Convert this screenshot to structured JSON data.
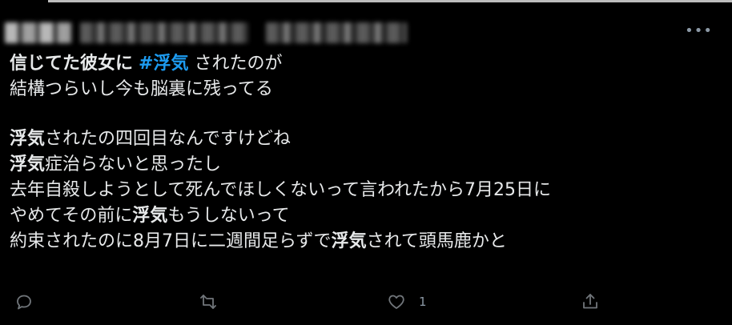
{
  "tweet": {
    "more_label": "•••",
    "segments": {
      "l1a": "信じてた彼女に",
      "l1tag": "#浮気",
      "l1b": "されたのが",
      "l2": "結構つらいし今も脳裏に残ってる",
      "l3a": "浮気",
      "l3b": "されたの四回目なんですけどね",
      "l4a": "浮気",
      "l4b": "症治らないと思ったし",
      "l5": "去年自殺しようとして死んでほしくないって言われたから7月25日に",
      "l6a": "やめてその前に",
      "l6b": "浮気",
      "l6c": "もうしないって",
      "l7a": "約束されたのに8月7日に二週間足らずで",
      "l7b": "浮気",
      "l7c": "されて頭馬鹿かと"
    },
    "actions": {
      "reply_icon": "reply-icon",
      "retweet_icon": "retweet-icon",
      "like_icon": "heart-icon",
      "like_count": "1",
      "share_icon": "share-icon"
    }
  },
  "colors": {
    "background": "#000000",
    "text": "#e7e9ea",
    "hashtag": "#1d9bf0",
    "icon": "#71767b"
  }
}
